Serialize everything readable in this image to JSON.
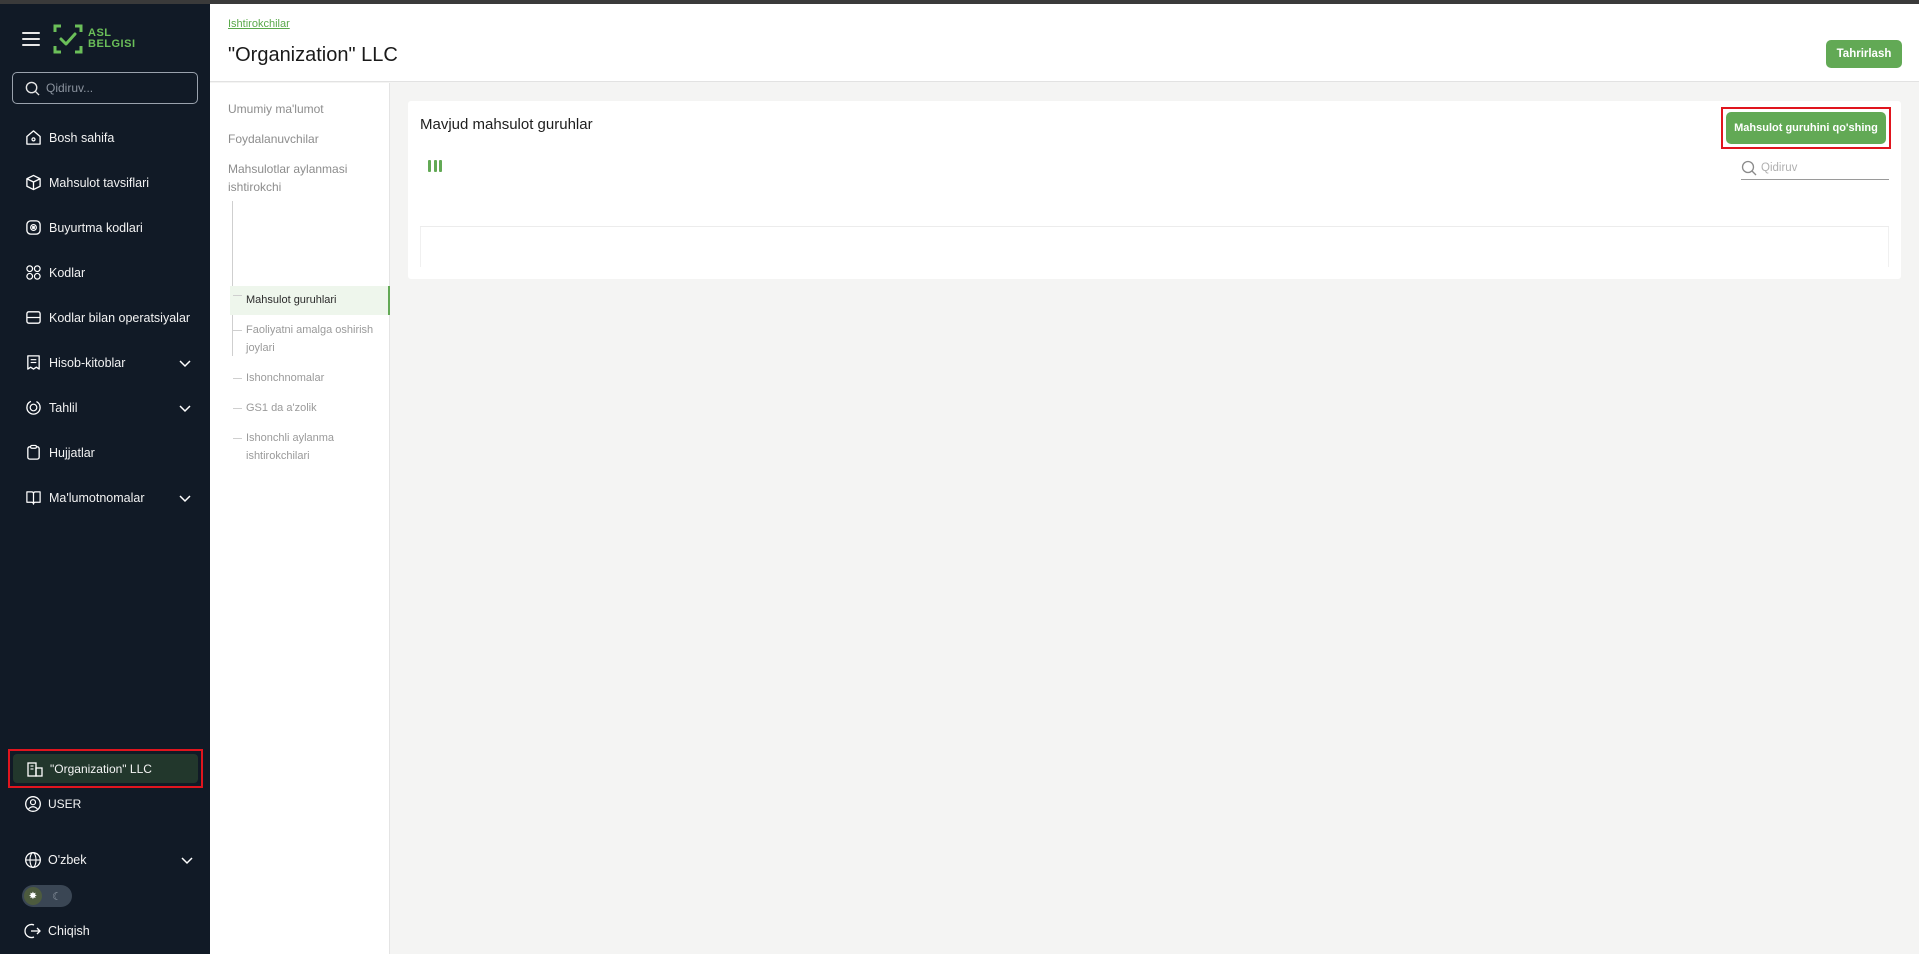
{
  "sidebar": {
    "logo_line1": "ASL",
    "logo_line2": "BELGISI",
    "search_placeholder": "Qidiruv...",
    "items": [
      {
        "label": "Bosh sahifa",
        "icon": "home-icon"
      },
      {
        "label": "Mahsulot tavsiflari",
        "icon": "box-icon"
      },
      {
        "label": "Buyurtma kodlari",
        "icon": "order-codes-icon"
      },
      {
        "label": "Kodlar",
        "icon": "codes-icon"
      },
      {
        "label": "Kodlar bilan operatsiyalar",
        "icon": "operations-icon"
      },
      {
        "label": "Hisob-kitoblar",
        "icon": "receipt-icon",
        "expandable": true
      },
      {
        "label": "Tahlil",
        "icon": "analytics-icon",
        "expandable": true
      },
      {
        "label": "Hujjatlar",
        "icon": "clipboard-icon"
      },
      {
        "label": "Ma'lumotnomalar",
        "icon": "book-icon",
        "expandable": true
      }
    ],
    "organization": "\"Organization\" LLC",
    "user": "USER",
    "language": "O'zbek",
    "logout": "Chiqish"
  },
  "header": {
    "breadcrumb": "Ishtirokchilar",
    "title": "\"Organization\" LLC",
    "edit_label": "Tahrirlash"
  },
  "subnav": {
    "items": [
      "Umumiy ma'lumot",
      "Foydalanuvchilar",
      "Mahsulotlar aylanmasi ishtirokchi"
    ],
    "tree": [
      "Mahsulot guruhlari",
      "Faoliyatni amalga oshirish joylari",
      "Ishonchnomalar",
      "GS1 da a'zolik",
      "Ishonchli aylanma ishtirokchilari"
    ],
    "active_index": 0
  },
  "main": {
    "title": "Mavjud mahsulot guruhlar",
    "add_label": "Mahsulot guruhini qo'shing",
    "search_placeholder": "Qidiruv"
  },
  "colors": {
    "sidebar_bg": "#111a26",
    "accent_green": "#62a955",
    "highlight_red": "#e0151e"
  }
}
